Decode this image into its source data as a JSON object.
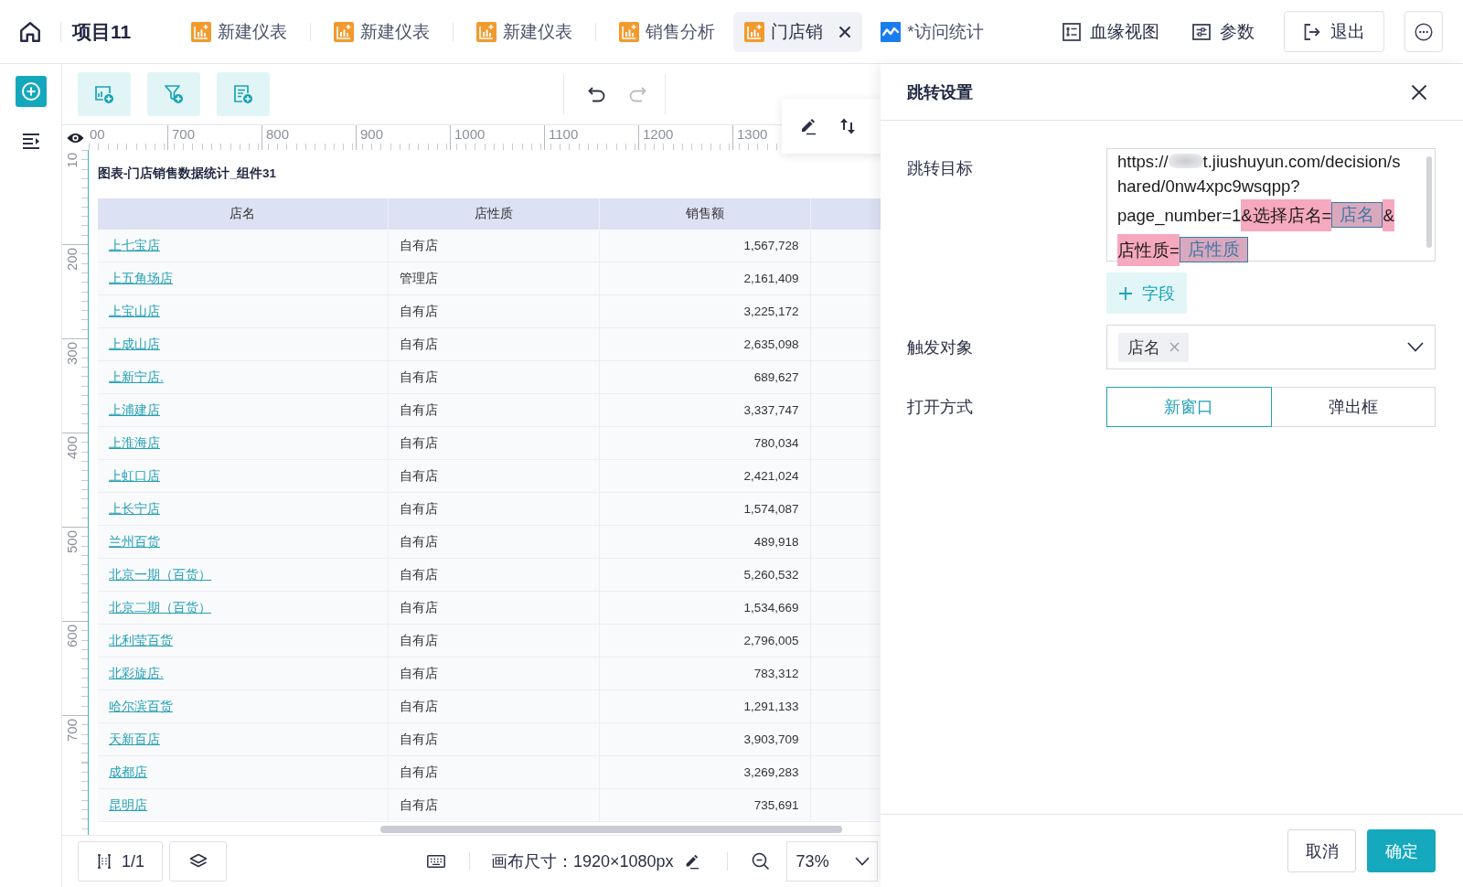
{
  "top_bar": {
    "project": "项目11",
    "tabs": [
      {
        "label": "新建仪表",
        "kind": "dashboard",
        "selected": false
      },
      {
        "label": "新建仪表",
        "kind": "dashboard",
        "selected": false
      },
      {
        "label": "新建仪表",
        "kind": "dashboard",
        "selected": false
      },
      {
        "label": "销售分析",
        "kind": "dashboard",
        "selected": false
      },
      {
        "label": "门店销",
        "kind": "dashboard",
        "selected": true
      },
      {
        "label": "*访问统计",
        "kind": "analysis",
        "selected": false
      }
    ],
    "actions": [
      {
        "label": "血缘视图",
        "kind": "lineage"
      },
      {
        "label": "参数",
        "kind": "parameters"
      }
    ],
    "exit_button": "退出"
  },
  "canvas_toolbar": {
    "history": [
      {
        "kind": "undo",
        "disabled": false
      },
      {
        "kind": "redo",
        "disabled": true
      }
    ]
  },
  "rulers": {
    "horizontal": [
      "00",
      "700",
      "800",
      "900",
      "1000",
      "1100",
      "1200",
      "1300"
    ],
    "vertical": [
      "10",
      "200",
      "300",
      "400",
      "500",
      "600",
      "700"
    ]
  },
  "widget": {
    "title": "图表-门店销售数据统计_组件31",
    "columns": [
      "店名",
      "店性质",
      "销售额"
    ],
    "rows": [
      {
        "store": "上七宝店",
        "type": "自有店",
        "sales": "1,567,728"
      },
      {
        "store": "上五角场店",
        "type": "管理店",
        "sales": "2,161,409"
      },
      {
        "store": "上宝山店",
        "type": "自有店",
        "sales": "3,225,172"
      },
      {
        "store": "上成山店",
        "type": "自有店",
        "sales": "2,635,098"
      },
      {
        "store": "上新宁店.",
        "type": "自有店",
        "sales": "689,627"
      },
      {
        "store": "上浦建店",
        "type": "自有店",
        "sales": "3,337,747"
      },
      {
        "store": "上淮海店",
        "type": "自有店",
        "sales": "780,034"
      },
      {
        "store": "上虹口店",
        "type": "自有店",
        "sales": "2,421,024"
      },
      {
        "store": "上长宁店",
        "type": "自有店",
        "sales": "1,574,087"
      },
      {
        "store": "兰州百货",
        "type": "自有店",
        "sales": "489,918"
      },
      {
        "store": "北京一期（百货）",
        "type": "自有店",
        "sales": "5,260,532"
      },
      {
        "store": "北京二期（百货）",
        "type": "自有店",
        "sales": "1,534,669"
      },
      {
        "store": "北利莹百货",
        "type": "自有店",
        "sales": "2,796,005"
      },
      {
        "store": "北彩旋店.",
        "type": "自有店",
        "sales": "783,312"
      },
      {
        "store": "哈尔滨百货",
        "type": "自有店",
        "sales": "1,291,133"
      },
      {
        "store": "天新百店",
        "type": "自有店",
        "sales": "3,903,709"
      },
      {
        "store": "成都店",
        "type": "自有店",
        "sales": "3,269,283"
      },
      {
        "store": "昆明店",
        "type": "自有店",
        "sales": "735,691"
      }
    ]
  },
  "bottom_bar": {
    "page": "1/1",
    "canvas_size": "画布尺寸：1920×1080px",
    "zoom": "73%"
  },
  "jump_panel": {
    "title": "跳转设置",
    "target_label": "跳转目标",
    "url_lines": [
      {
        "segments": [
          {
            "kind": "text",
            "text": "https://",
            "highlighted": false
          },
          {
            "kind": "redacted",
            "highlighted": false
          },
          {
            "kind": "text",
            "text": "t.jiushuyun.com/decision/s",
            "highlighted": false
          }
        ]
      },
      {
        "segments": [
          {
            "kind": "text",
            "text": "hared/0nw4xpc9wsqpp?",
            "highlighted": false
          }
        ]
      },
      {
        "segments": [
          {
            "kind": "text",
            "text": "page_number=1",
            "highlighted": false
          },
          {
            "kind": "text",
            "text": "&选择店名=",
            "highlighted": true
          },
          {
            "kind": "field",
            "text": "店名",
            "highlighted": true
          },
          {
            "kind": "text",
            "text": "&",
            "highlighted": true
          }
        ]
      },
      {
        "segments": [
          {
            "kind": "text",
            "text": "店性质=",
            "highlighted": true
          },
          {
            "kind": "field",
            "text": "店性质",
            "highlighted": true
          }
        ]
      }
    ],
    "add_field_button": "字段",
    "trigger_label": "触发对象",
    "trigger_tags": [
      "店名"
    ],
    "open_label": "打开方式",
    "open_options": [
      {
        "label": "新窗口",
        "selected": true
      },
      {
        "label": "弹出框",
        "selected": false
      }
    ],
    "cancel_button": "取消",
    "confirm_button": "确定"
  }
}
